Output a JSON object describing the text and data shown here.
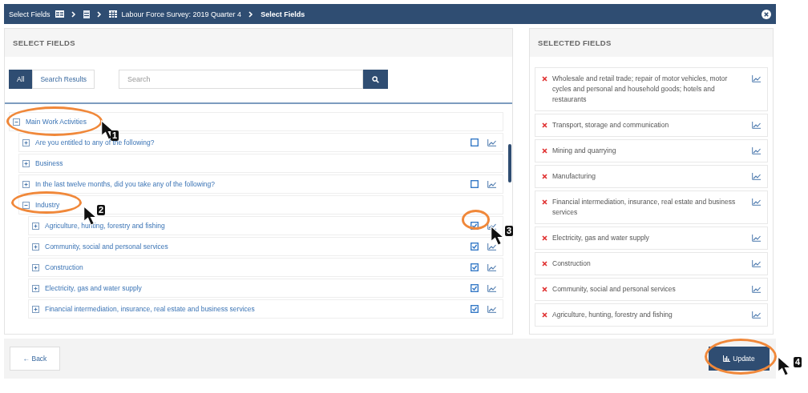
{
  "breadcrumb": {
    "items": [
      {
        "label": "Select Fields"
      },
      {
        "kind": "icon"
      },
      {
        "label": "Labour Force Survey: 2019 Quarter 4"
      },
      {
        "label": "Select Fields",
        "current": true
      }
    ]
  },
  "select_fields": {
    "title": "SELECT FIELDS",
    "tabs": [
      {
        "label": "All",
        "selected": true
      },
      {
        "label": "Search Results",
        "selected": false
      }
    ],
    "search": {
      "placeholder": "Search"
    },
    "tree": [
      {
        "label": "Main Work Activities",
        "expanded": true,
        "children": [
          {
            "label": "Are you entitled to any of the following?",
            "expanded": false,
            "checked": false
          },
          {
            "label": "Business",
            "expanded": false
          },
          {
            "label": "In the last twelve months, did you take any of the following?",
            "expanded": false,
            "checked": false
          },
          {
            "label": "Industry",
            "expanded": true,
            "children": [
              {
                "label": "Agriculture, hunting, forestry and fishing",
                "expanded": false,
                "checked": true
              },
              {
                "label": "Community, social and personal services",
                "expanded": false,
                "checked": true
              },
              {
                "label": "Construction",
                "expanded": false,
                "checked": true
              },
              {
                "label": "Electricity, gas and water supply",
                "expanded": false,
                "checked": true
              },
              {
                "label": "Financial intermediation, insurance, real estate and business services",
                "expanded": false,
                "checked": true
              }
            ]
          }
        ]
      }
    ]
  },
  "selected_fields": {
    "title": "SELECTED FIELDS",
    "items": [
      "Wholesale and retail trade; repair of motor vehicles, motor cycles and personal and household goods; hotels and restaurants",
      "Transport, storage and communication",
      "Mining and quarrying",
      "Manufacturing",
      "Financial intermediation, insurance, real estate and business services",
      "Electricity, gas and water supply",
      "Construction",
      "Community, social and personal services",
      "Agriculture, hunting, forestry and fishing"
    ]
  },
  "footer": {
    "back": "← Back",
    "update": "Update"
  },
  "annotations": [
    {
      "number": "1"
    },
    {
      "number": "2"
    },
    {
      "number": "3"
    },
    {
      "number": "4"
    }
  ]
}
